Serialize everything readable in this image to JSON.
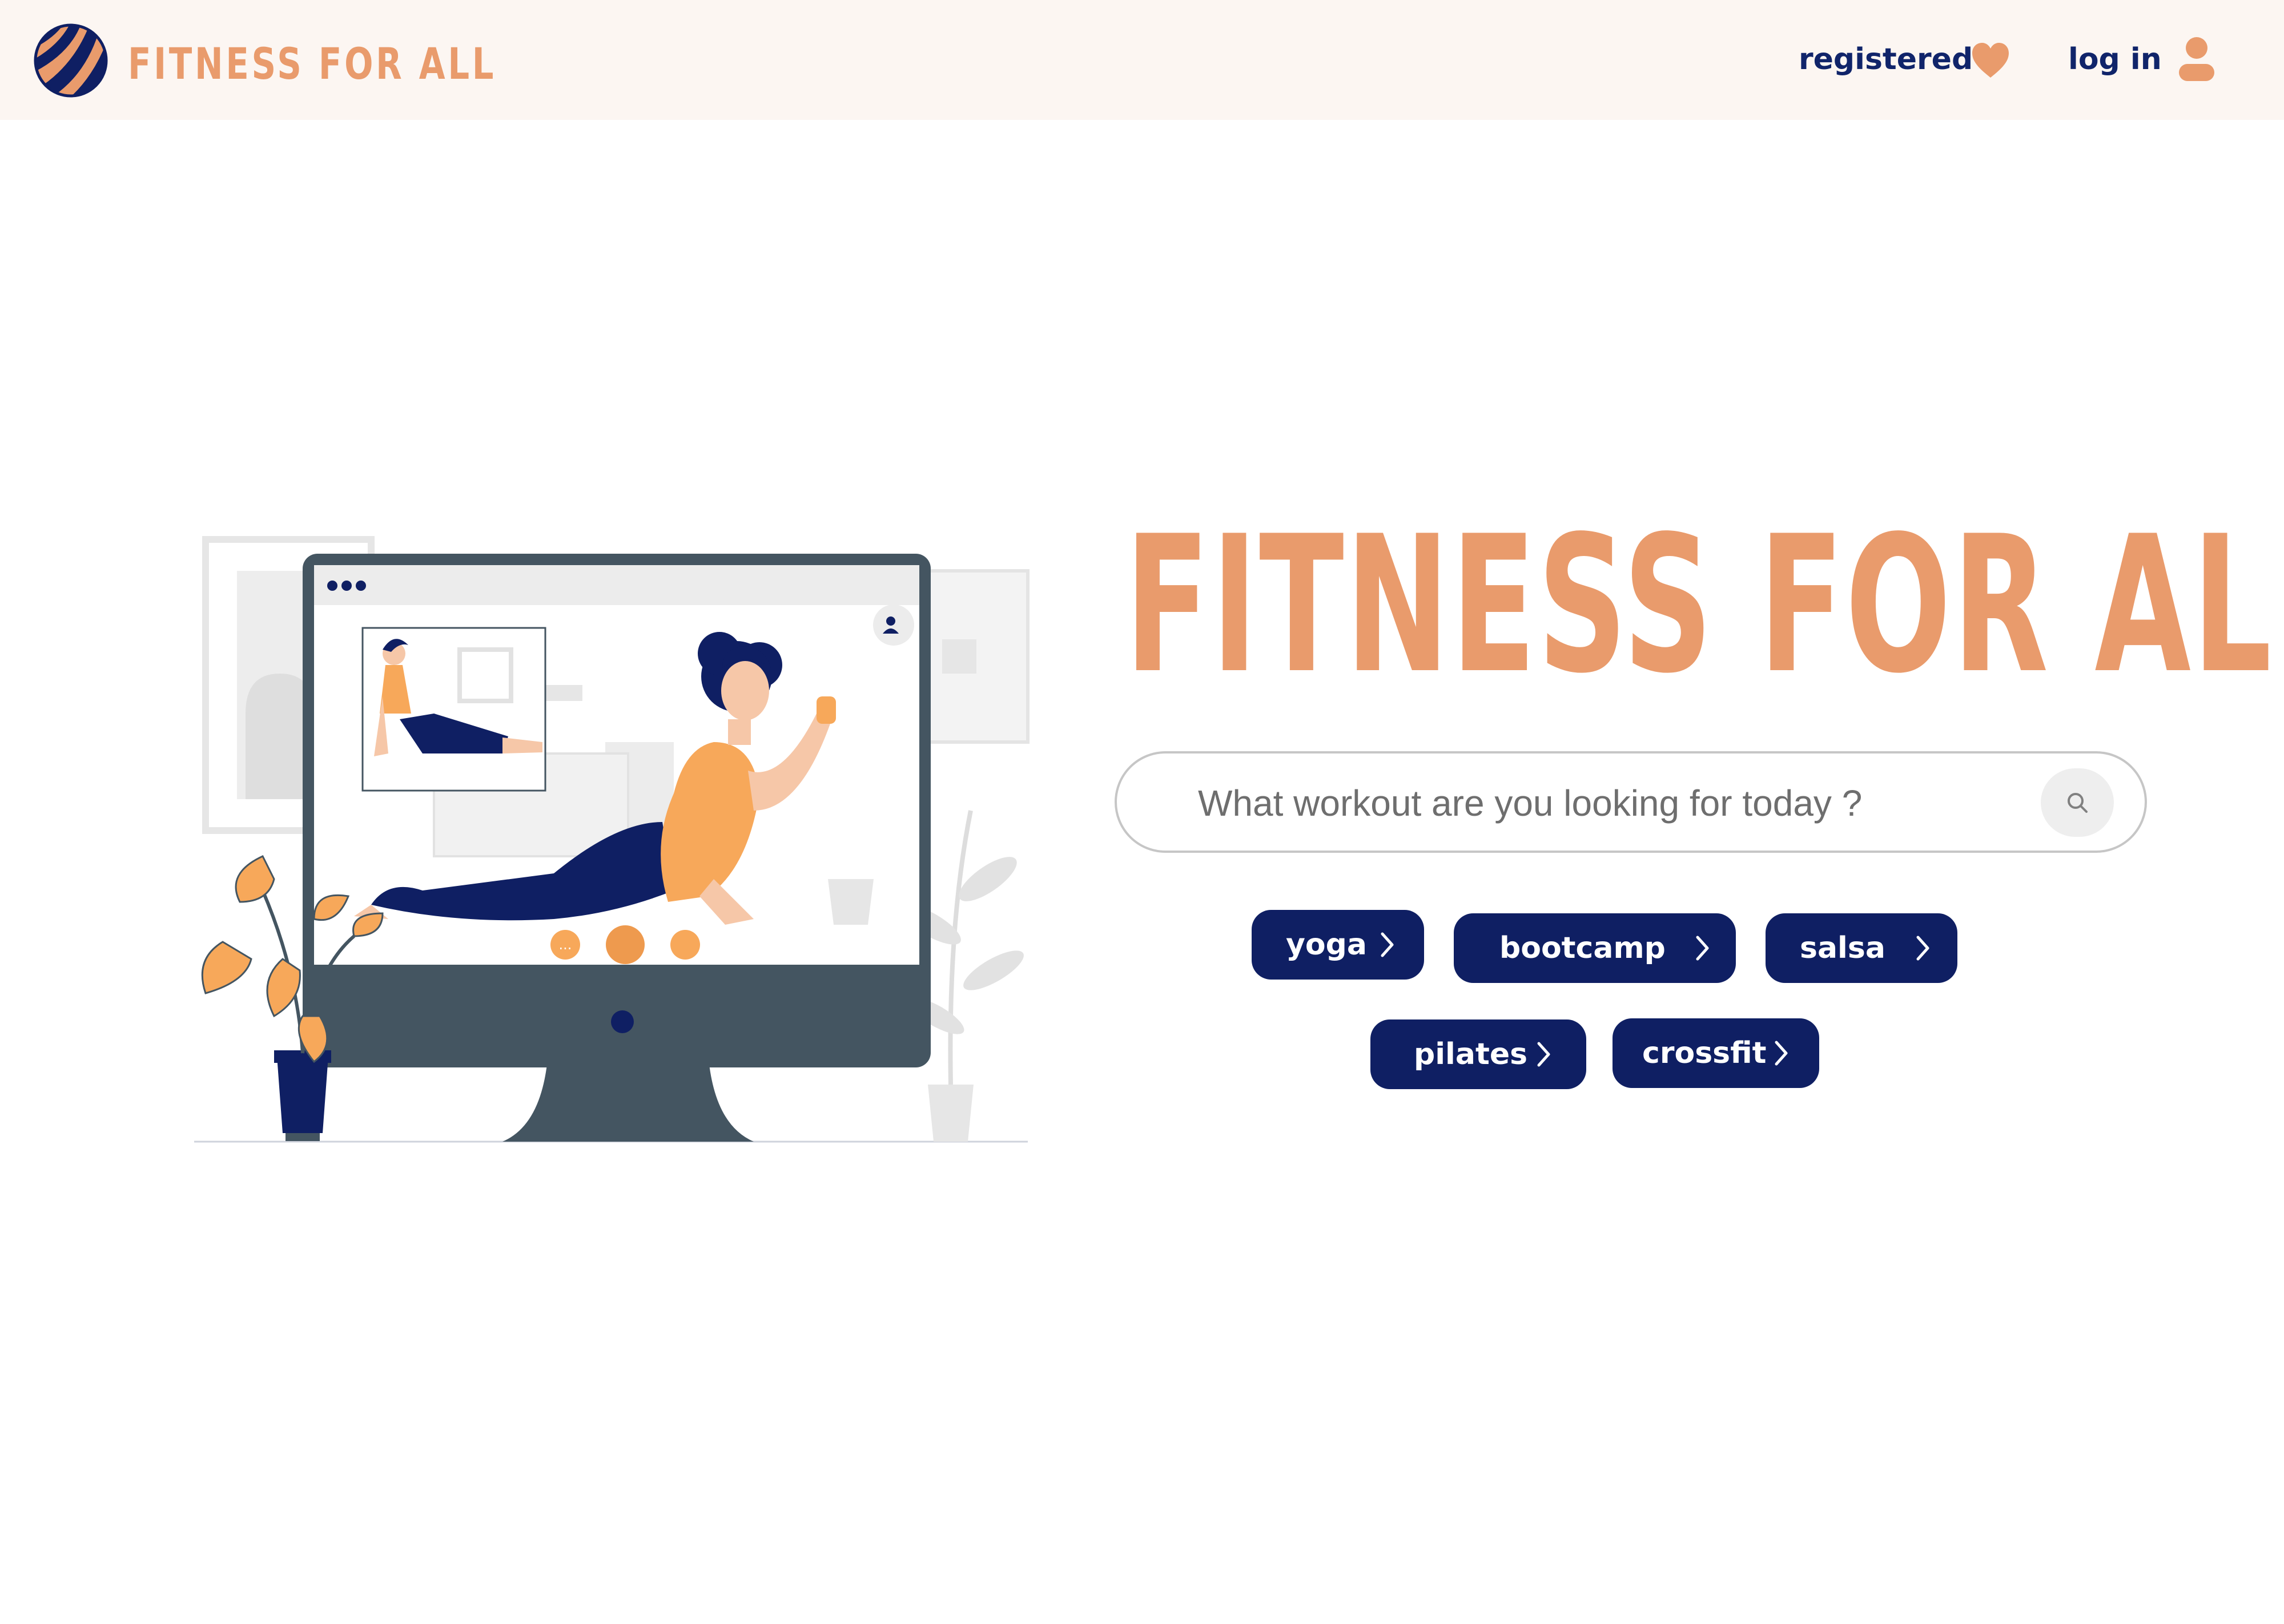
{
  "brand": {
    "name": "FITNESS FOR ALL",
    "color_orange": "#e99b6c",
    "color_navy": "#0f1f63",
    "header_bg": "#fcf6f2"
  },
  "nav": {
    "registered_label": "registered",
    "login_label": "log in",
    "registered_icon": "heart-icon",
    "login_icon": "user-icon"
  },
  "hero": {
    "title": "FITNESS FOR ALL",
    "search": {
      "placeholder": "What workout are you looking for today ?",
      "value": "",
      "icon": "search-icon"
    },
    "categories": [
      {
        "label": "yoga"
      },
      {
        "label": "bootcamp"
      },
      {
        "label": "salsa"
      },
      {
        "label": "pilates"
      },
      {
        "label": "crossfit"
      }
    ]
  }
}
